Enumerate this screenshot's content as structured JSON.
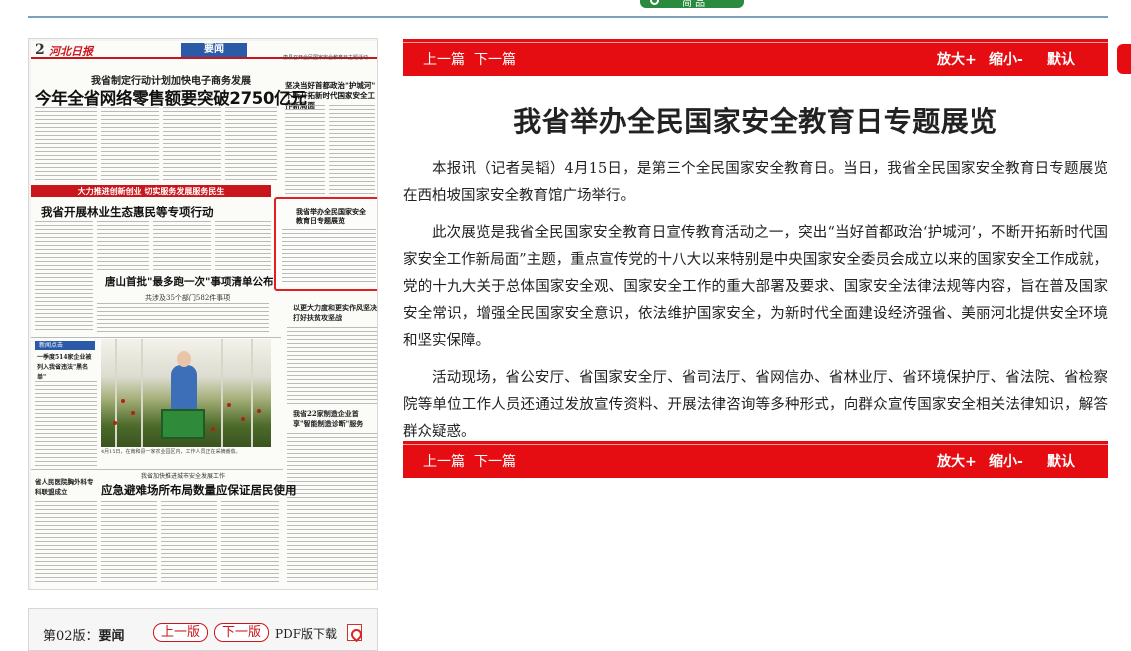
{
  "header": {
    "badge_text": "简 品"
  },
  "paper": {
    "page_number": "2",
    "logo_text": "河北日报",
    "section": "要闻",
    "sub_headline": "我省制定行动计划加快电子商务发展",
    "lead_headline": "今年全省网络零售额要突破2750亿元",
    "right_top_text": "唐县召开全民国家安全教育日主题活动",
    "right_headline": "坚决当好首都政治\"护城河\" 不断开拓新时代国家安全工作新局面",
    "red_band": "大力推进创新创业 切实服务发展服务民生",
    "headline_forest": "我省开展林业生态惠民等专项行动",
    "headline_tangshan": "唐山首批\"最多跑一次\"事项清单公布",
    "sub_tangshan": "共涉及35个部门582件事项",
    "highlight_title": "我省举办全民国家安全教育日专题展览",
    "right_mid_head": "以更大力度和更实作风坚决打好扶贫攻坚战",
    "blue_label": "新闻点击",
    "left_heads": "一季度514家企业被列入我省违法\"黑名单\"",
    "photo_caption": "4月15日，在南和县一家农业园区内，工作人员正在采摘番茄。",
    "right_head2": "我省22家制造企业首享\"智能制造诊断\"服务",
    "sub_emergency": "我省加快推进城市安全发展工作",
    "headline_emergency": "应急避难场所布局数量应保证居民使用",
    "left_head6": "省人民医院胸外科专科联盟成立"
  },
  "page_nav": {
    "page_label_prefix": "第02版：",
    "page_label_name": "要闻",
    "prev_label": "上一版",
    "next_label": "下一版",
    "pdf_label": "PDF版下载"
  },
  "toolbar": {
    "prev_article": "上一篇",
    "next_article": "下一篇",
    "zoom_in": "放大+",
    "zoom_out": "缩小-",
    "default": "默认"
  },
  "article": {
    "title": "我省举办全民国家安全教育日专题展览",
    "paragraphs": [
      "本报讯（记者吴韬）4月15日，是第三个全民国家安全教育日。当日，我省全民国家安全教育日专题展览在西柏坡国家安全教育馆广场举行。",
      "此次展览是我省全民国家安全教育日宣传教育活动之一，突出“当好首都政治‘护城河’，不断开拓新时代国家安全工作新局面”主题，重点宣传党的十八大以来特别是中央国家安全委员会成立以来的国家安全工作成就，党的十九大关于总体国家安全观、国家安全工作的重大部署及要求、国家安全法律法规等内容，旨在普及国家安全常识，增强全民国家安全意识，依法维护国家安全，为新时代全面建设经济强省、美丽河北提供安全环境和坚实保障。",
      "活动现场，省公安厅、省国家安全厅、省司法厅、省网信办、省林业厅、省环境保护厅、省法院、省检察院等单位工作人员还通过发放宣传资料、开展法律咨询等多种形式，向群众宣传国家安全相关法律知识，解答群众疑惑。"
    ]
  }
}
